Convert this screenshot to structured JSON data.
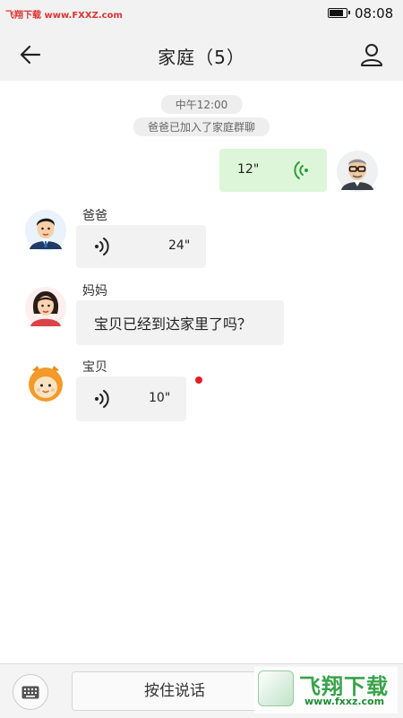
{
  "status_bar": {
    "watermark_text": "飞翔下载 www.FXXZ.com",
    "time": "08:08",
    "battery_level": 0.9
  },
  "header": {
    "title": "家庭（5）",
    "back_icon": "arrow-left-icon",
    "profile_icon": "person-icon"
  },
  "chat": {
    "time_label": "中午12:00",
    "system_notice": "爸爸已加入了家庭群聊",
    "messages": [
      {
        "sender": "",
        "side": "right",
        "type": "voice",
        "duration": "12\"",
        "avatar": "grandpa-avatar"
      },
      {
        "sender": "爸爸",
        "side": "left",
        "type": "voice",
        "duration": "24\"",
        "avatar": "dad-avatar"
      },
      {
        "sender": "妈妈",
        "side": "left",
        "type": "text",
        "text": "宝贝已经到达家里了吗？",
        "avatar": "mom-avatar"
      },
      {
        "sender": "宝贝",
        "side": "left",
        "type": "voice",
        "duration": "10\"",
        "avatar": "baby-avatar",
        "unread": true
      }
    ]
  },
  "bottom_bar": {
    "keyboard_icon": "keyboard-icon",
    "hold_to_talk": "按住说话"
  },
  "watermark": {
    "main": "飞翔下载",
    "sub": "www.fxxz.com"
  },
  "colors": {
    "header_bg": "#f2f2f2",
    "incoming_bubble": "#f2f2f2",
    "outgoing_bubble": "#ddf5d9",
    "voice_green": "#2e9b3a",
    "unread_red": "#e02020"
  }
}
